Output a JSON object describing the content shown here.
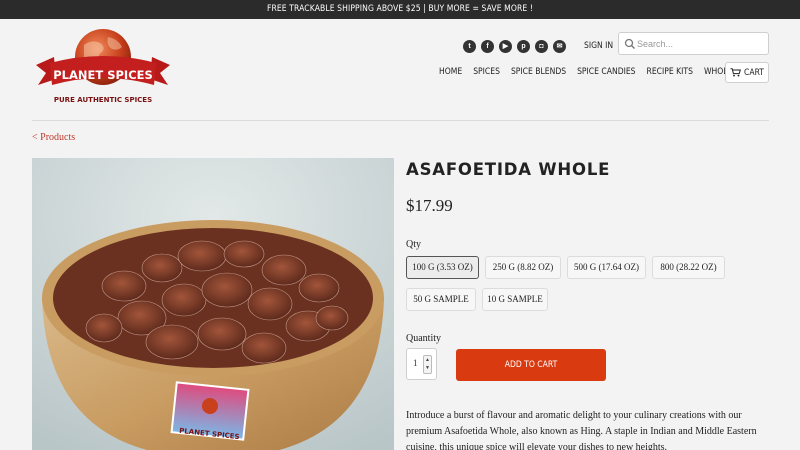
{
  "announcement": "FREE TRACKABLE SHIPPING ABOVE $25 | BUY MORE = SAVE MORE !",
  "brand": {
    "name": "PLANET SPICES",
    "tagline": "PURE AUTHENTIC SPICES"
  },
  "header": {
    "social_icons": [
      "twitter-icon",
      "facebook-icon",
      "youtube-icon",
      "pinterest-icon",
      "instagram-icon",
      "email-icon"
    ],
    "signin": "SIGN IN",
    "search_placeholder": "Search...",
    "nav": [
      "HOME",
      "SPICES",
      "SPICE BLENDS",
      "SPICE CANDIES",
      "RECIPE KITS",
      "WHOLESALE"
    ],
    "cart": "CART"
  },
  "breadcrumb": "< Products",
  "product": {
    "title": "ASAFOETIDA WHOLE",
    "price": "$17.99",
    "qty_label": "Qty",
    "variants": [
      "100 G (3.53 OZ)",
      "250 G (8.82 OZ)",
      "500 G (17.64 OZ)",
      "800 (28.22 OZ)",
      "50 G SAMPLE",
      "10 G SAMPLE"
    ],
    "selected_variant": "100 G (3.53 OZ)",
    "quantity_label": "Quantity",
    "quantity_value": "1",
    "add_to_cart": "ADD TO CART",
    "description": "Introduce a burst of flavour and aromatic delight to your culinary creations with our premium Asafoetida Whole, also known as Hing. A staple in Indian and Middle Eastern cuisine, this unique spice will elevate your dishes to new heights."
  },
  "colors": {
    "accent": "#d93a10",
    "link": "#c0392b",
    "topbar": "#2b2b2b"
  }
}
